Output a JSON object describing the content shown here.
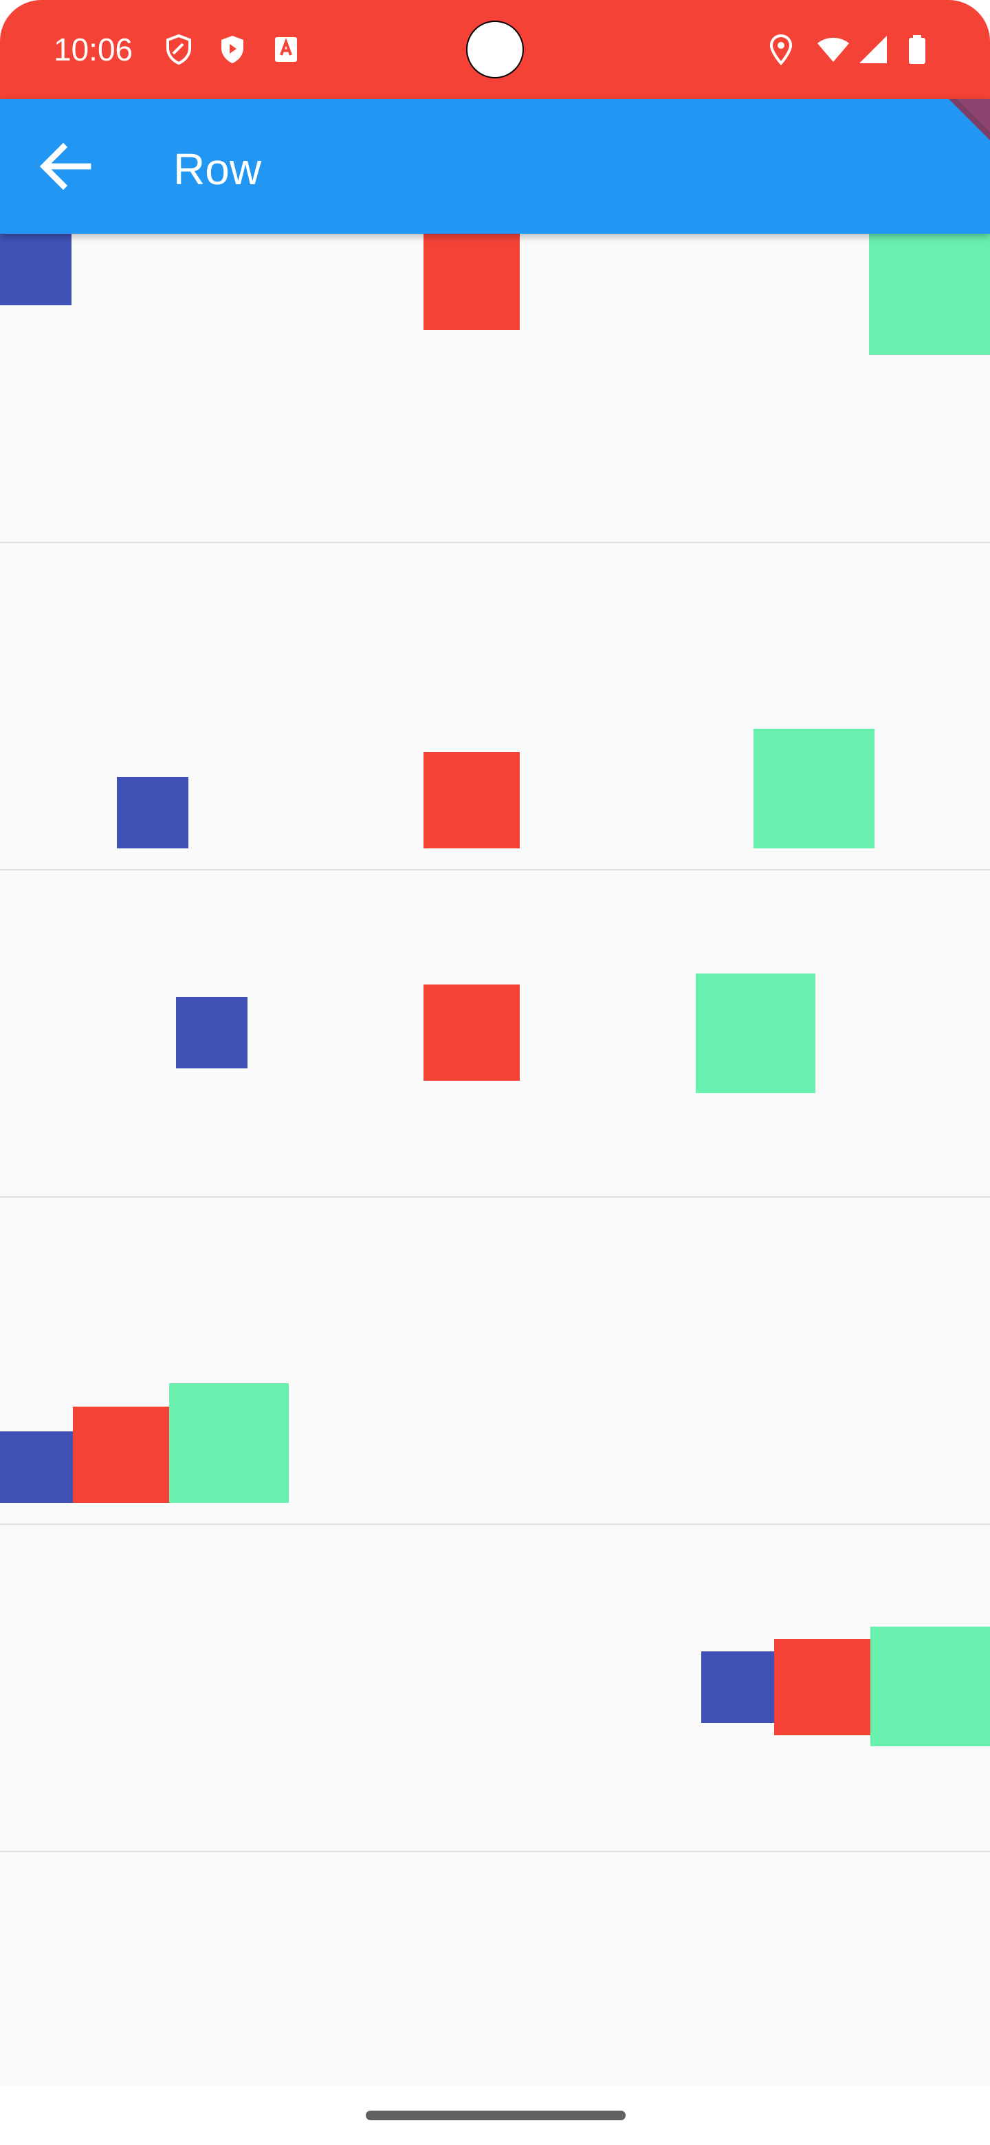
{
  "status_bar": {
    "time": "10:06",
    "icons": [
      "shield-outline-icon",
      "shield-play-icon",
      "font-a-icon",
      "location-pin-icon",
      "wifi-icon",
      "cell-signal-icon",
      "battery-icon"
    ]
  },
  "app_bar": {
    "title": "Row",
    "back_icon": "arrow-left-icon"
  },
  "colors": {
    "status_bar": "#F44336",
    "app_bar": "#2196F3",
    "background": "#FAFAFA",
    "box_small": "#3F51B5",
    "box_medium": "#F44336",
    "box_large": "#69F0AE",
    "divider": "#E0E0E0"
  },
  "rows": [
    {
      "name": "row-1",
      "boxes": [
        "box_small",
        "box_medium",
        "box_large"
      ]
    },
    {
      "name": "row-2",
      "boxes": [
        "box_small",
        "box_medium",
        "box_large"
      ]
    },
    {
      "name": "row-3",
      "boxes": [
        "box_small",
        "box_medium",
        "box_large"
      ]
    },
    {
      "name": "row-4",
      "boxes": [
        "box_small",
        "box_medium",
        "box_large"
      ]
    },
    {
      "name": "row-5",
      "boxes": [
        "box_small",
        "box_medium",
        "box_large"
      ]
    },
    {
      "name": "row-6",
      "boxes": []
    }
  ]
}
